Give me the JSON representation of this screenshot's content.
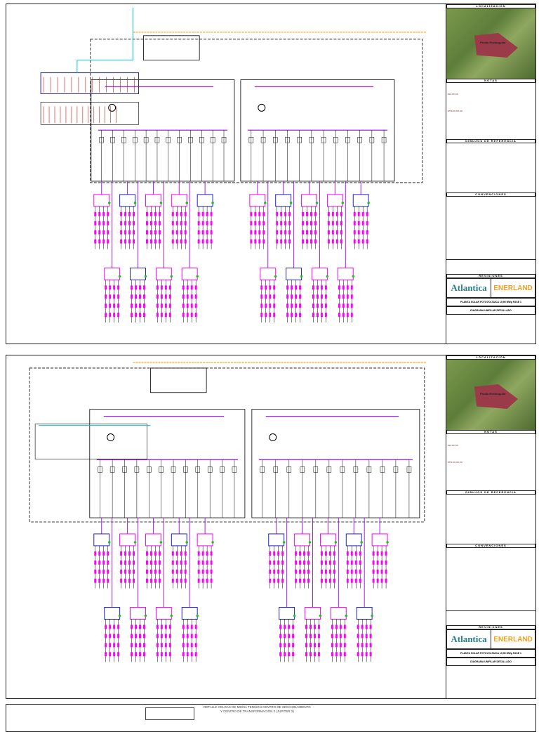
{
  "titleblock": {
    "localizacion": "LOCALIZACIÓN",
    "lot_label": "Predio Rectangular",
    "notas": "NOTAS",
    "note_code_1": "INV-XX-XX",
    "note_code_2": "STR-XX-XX-XX",
    "dibujos": "DIBUJOS DE REFERENCIA",
    "convenciones": "CONVENCIONES",
    "revisiones": "REVISIONES",
    "client": "Atlantica",
    "contractor": "ENERLAND",
    "project": "PLANTA SOLAR FOTOVOLTAICA 19,95 MWp FASE 1",
    "drawing": "DIAGRAMA UNIFILAR DETALLADO"
  },
  "bottom_sheet": {
    "title_line1": "DETALLE CELDAS DE MEDIA TENSIÓN CENTRO DE SECCIONAMIENTO",
    "title_line2": "Y CENTRO DE TRANSFORMACIÓN 2 (JUPITER 2)"
  },
  "colors": {
    "mv": "#a020f0",
    "dc": "#ff00ff",
    "lv": "#00c8e0",
    "feeder": "#ff8c00",
    "inv_blue": "#2020d0"
  }
}
